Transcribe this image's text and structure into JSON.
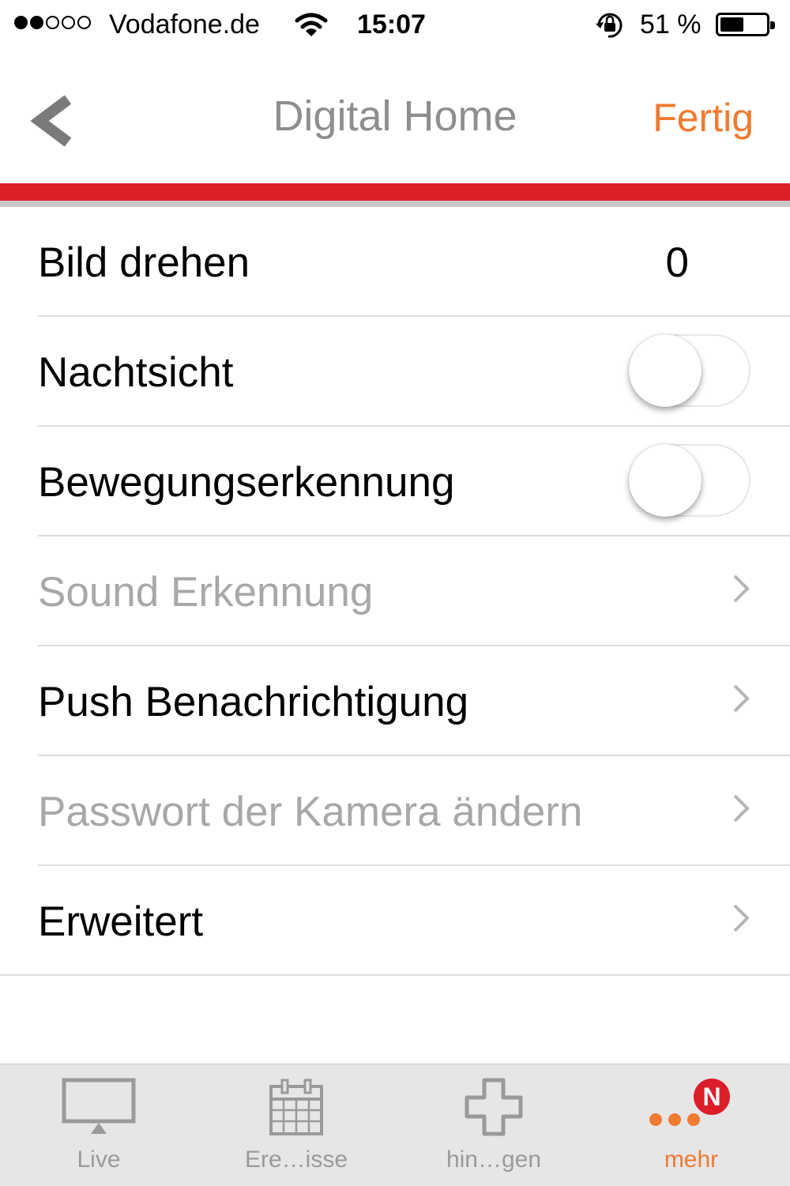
{
  "status_bar": {
    "carrier": "Vodafone.de",
    "time": "15:07",
    "battery_percent": "51 %",
    "battery_level": 0.51,
    "signal_bars_filled": 2,
    "signal_bars_total": 5
  },
  "nav": {
    "title": "Digital Home",
    "done_label": "Fertig"
  },
  "settings": {
    "rows": [
      {
        "label": "Bild drehen",
        "value": "0"
      },
      {
        "label": "Nachtsicht",
        "toggle_on": false
      },
      {
        "label": "Bewegungserkennung",
        "toggle_on": false
      },
      {
        "label": "Sound Erkennung",
        "disabled": true
      },
      {
        "label": "Push Benachrichtigung"
      },
      {
        "label": "Passwort der Kamera ändern",
        "disabled": true
      },
      {
        "label": "Erweitert"
      }
    ]
  },
  "tabs": [
    {
      "label": "Live",
      "icon": "monitor-icon"
    },
    {
      "label": "Ere…isse",
      "icon": "calendar-icon"
    },
    {
      "label": "hin…gen",
      "icon": "plus-icon"
    },
    {
      "label": "mehr",
      "icon": "more-dots-icon",
      "badge": "N",
      "active": true
    }
  ],
  "colors": {
    "accent_orange": "#f07a2f",
    "brand_red": "#dc1e29",
    "disabled_text": "#a8a8a8"
  }
}
